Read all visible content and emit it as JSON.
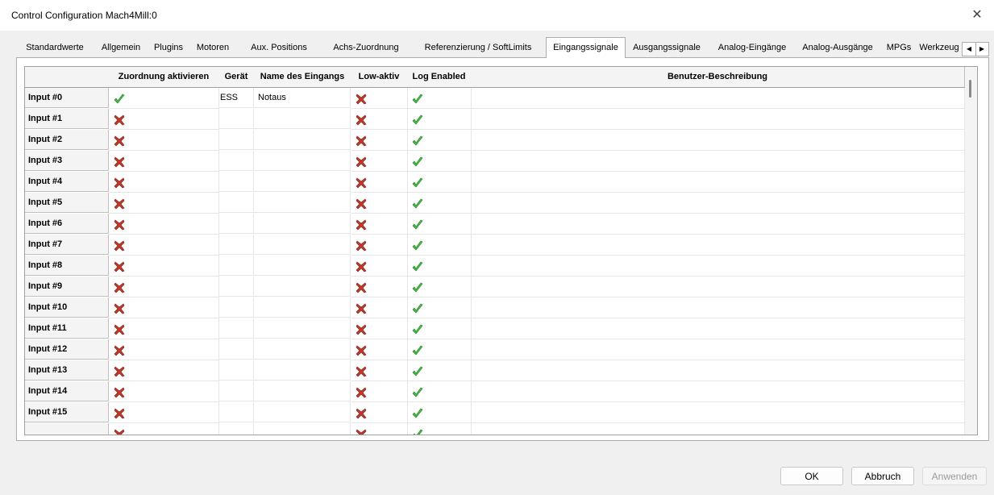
{
  "window": {
    "title": "Control Configuration Mach4Mill:0",
    "close_label": "✕"
  },
  "tabs": [
    {
      "label": "Standardwerte"
    },
    {
      "label": "Allgemein"
    },
    {
      "label": "Plugins"
    },
    {
      "label": "Motoren"
    },
    {
      "label": "Aux. Positions"
    },
    {
      "label": "Achs-Zuordnung"
    },
    {
      "label": "Referenzierung / SoftLimits"
    },
    {
      "label": "Eingangssignale"
    },
    {
      "label": "Ausgangssignale"
    },
    {
      "label": "Analog-Eingänge"
    },
    {
      "label": "Analog-Ausgänge"
    },
    {
      "label": "MPGs"
    },
    {
      "label": "Werkzeug"
    }
  ],
  "active_tab": "Eingangssignale",
  "tab_scroll": {
    "left": "◀",
    "right": "▶"
  },
  "grid": {
    "columns": [
      "Zuordnung aktivieren",
      "Gerät",
      "Name des Eingangs",
      "Low-aktiv",
      "Log Enabled",
      "Benutzer-Beschreibung"
    ],
    "rows": [
      {
        "label": "Input #0",
        "enabled": true,
        "device": "ESS",
        "name": "Notaus",
        "low_active": false,
        "log_enabled": true,
        "description": ""
      },
      {
        "label": "Input #1",
        "enabled": false,
        "device": "",
        "name": "",
        "low_active": false,
        "log_enabled": true,
        "description": ""
      },
      {
        "label": "Input #2",
        "enabled": false,
        "device": "",
        "name": "",
        "low_active": false,
        "log_enabled": true,
        "description": ""
      },
      {
        "label": "Input #3",
        "enabled": false,
        "device": "",
        "name": "",
        "low_active": false,
        "log_enabled": true,
        "description": ""
      },
      {
        "label": "Input #4",
        "enabled": false,
        "device": "",
        "name": "",
        "low_active": false,
        "log_enabled": true,
        "description": ""
      },
      {
        "label": "Input #5",
        "enabled": false,
        "device": "",
        "name": "",
        "low_active": false,
        "log_enabled": true,
        "description": ""
      },
      {
        "label": "Input #6",
        "enabled": false,
        "device": "",
        "name": "",
        "low_active": false,
        "log_enabled": true,
        "description": ""
      },
      {
        "label": "Input #7",
        "enabled": false,
        "device": "",
        "name": "",
        "low_active": false,
        "log_enabled": true,
        "description": ""
      },
      {
        "label": "Input #8",
        "enabled": false,
        "device": "",
        "name": "",
        "low_active": false,
        "log_enabled": true,
        "description": ""
      },
      {
        "label": "Input #9",
        "enabled": false,
        "device": "",
        "name": "",
        "low_active": false,
        "log_enabled": true,
        "description": ""
      },
      {
        "label": "Input #10",
        "enabled": false,
        "device": "",
        "name": "",
        "low_active": false,
        "log_enabled": true,
        "description": ""
      },
      {
        "label": "Input #11",
        "enabled": false,
        "device": "",
        "name": "",
        "low_active": false,
        "log_enabled": true,
        "description": ""
      },
      {
        "label": "Input #12",
        "enabled": false,
        "device": "",
        "name": "",
        "low_active": false,
        "log_enabled": true,
        "description": ""
      },
      {
        "label": "Input #13",
        "enabled": false,
        "device": "",
        "name": "",
        "low_active": false,
        "log_enabled": true,
        "description": ""
      },
      {
        "label": "Input #14",
        "enabled": false,
        "device": "",
        "name": "",
        "low_active": false,
        "log_enabled": true,
        "description": ""
      },
      {
        "label": "Input #15",
        "enabled": false,
        "device": "",
        "name": "",
        "low_active": false,
        "log_enabled": true,
        "description": ""
      },
      {
        "label": "",
        "enabled": false,
        "device": "",
        "name": "",
        "low_active": false,
        "log_enabled": true,
        "description": ""
      }
    ]
  },
  "buttons": {
    "ok": "OK",
    "cancel": "Abbruch",
    "apply": "Anwenden"
  },
  "colors": {
    "check_green": "#3fbf3f",
    "cross_red": "#c0392b"
  }
}
